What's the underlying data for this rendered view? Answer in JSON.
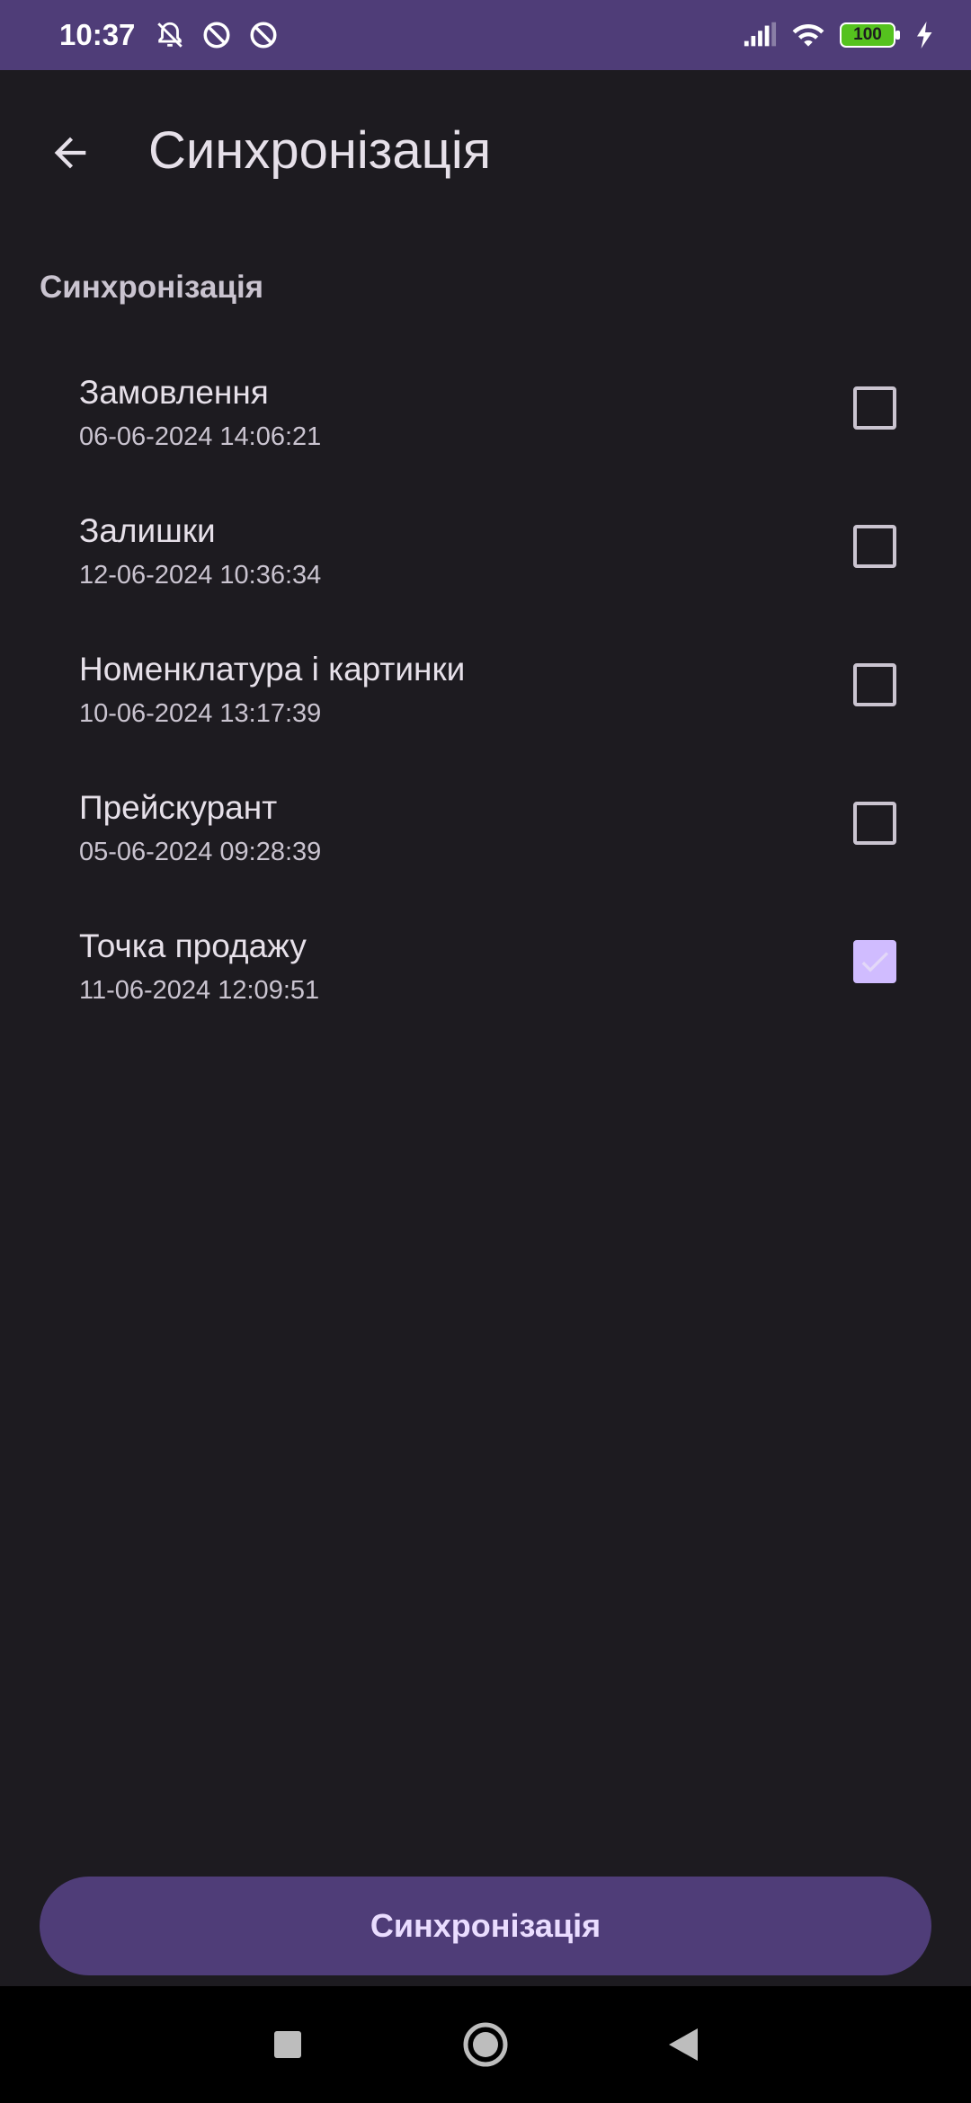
{
  "status_bar": {
    "time": "10:37",
    "battery": "100",
    "icons_left": [
      "muted-bell-icon",
      "dnd-icon",
      "dnd-icon"
    ],
    "icons_right": [
      "signal-icon",
      "wifi-icon",
      "battery-icon",
      "charging-icon"
    ]
  },
  "app_bar": {
    "title": "Синхронізація",
    "back_icon": "arrow-back-icon"
  },
  "section": {
    "header": "Синхронізація"
  },
  "items": [
    {
      "title": "Замовлення",
      "date": "06-06-2024 14:06:21",
      "checked": false
    },
    {
      "title": "Залишки",
      "date": "12-06-2024 10:36:34",
      "checked": false
    },
    {
      "title": "Номенклатура і картинки",
      "date": "10-06-2024 13:17:39",
      "checked": false
    },
    {
      "title": "Прейскурант",
      "date": "05-06-2024 09:28:39",
      "checked": false
    },
    {
      "title": "Точка продажу",
      "date": "11-06-2024 12:09:51",
      "checked": true
    }
  ],
  "sync_button": {
    "label": "Синхронізація"
  },
  "colors": {
    "status_bar": "#4f3d78",
    "background": "#1d1b20",
    "accent": "#d0bcff",
    "button_bg": "#4f3d78",
    "button_text": "#eaddff"
  },
  "nav_bar": {
    "buttons": [
      "recents-icon",
      "home-icon",
      "back-icon"
    ]
  }
}
